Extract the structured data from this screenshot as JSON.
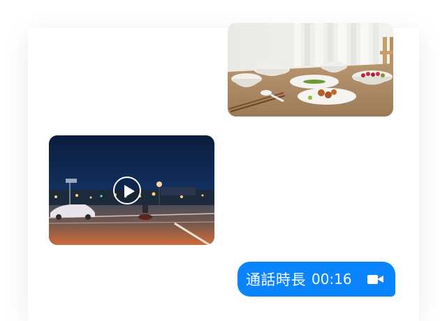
{
  "messages": {
    "photo": {
      "type": "image",
      "subject": "dining-table"
    },
    "video": {
      "type": "video",
      "subject": "night-street"
    },
    "call": {
      "label": "通話時長",
      "duration": "00:16",
      "icon": "video-camera-icon"
    }
  },
  "colors": {
    "call_bubble": "#0a84ff",
    "background": "#ffffff",
    "card": "#ffffff"
  }
}
